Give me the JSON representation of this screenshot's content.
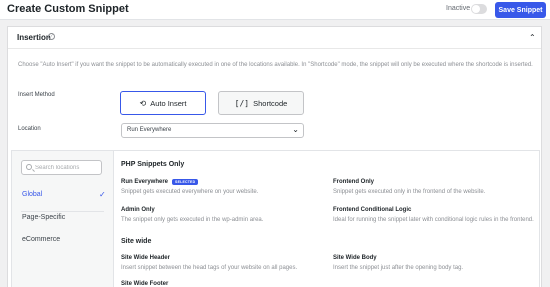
{
  "header": {
    "title": "Create Custom Snippet",
    "status_label": "Inactive",
    "save_label": "Save Snippet"
  },
  "insertion": {
    "title": "Insertion",
    "description": "Choose \"Auto Insert\" if you want the snippet to be automatically executed in one of the locations available. In \"Shortcode\" mode, the snippet will only be executed where the shortcode is inserted.",
    "method_label": "Insert Method",
    "methods": [
      {
        "icon": "refresh-icon",
        "label": "Auto Insert",
        "selected": true
      },
      {
        "icon": "shortcode-icon",
        "label": "Shortcode",
        "selected": false
      }
    ],
    "location_label": "Location",
    "location_value": "Run Everywhere"
  },
  "locations": {
    "search_placeholder": "Search locations",
    "nav": [
      {
        "label": "Global",
        "active": true
      },
      {
        "label": "Page-Specific",
        "active": false
      },
      {
        "label": "eCommerce",
        "active": false
      }
    ],
    "groups": [
      {
        "title": "PHP Snippets Only",
        "options": [
          {
            "title": "Run Everywhere",
            "badge": "SELECTED",
            "desc": "Snippet gets executed everywhere on your website."
          },
          {
            "title": "Frontend Only",
            "desc": "Snippet gets executed only in the frontend of the website."
          },
          {
            "title": "Admin Only",
            "desc": "The snippet only gets executed in the wp-admin area."
          },
          {
            "title": "Frontend Conditional Logic",
            "desc": "Ideal for running the snippet later with conditional logic rules in the frontend."
          }
        ]
      },
      {
        "title": "Site wide",
        "options": [
          {
            "title": "Site Wide Header",
            "desc": "Insert snippet between the head tags of your website on all pages."
          },
          {
            "title": "Site Wide Body",
            "desc": "Insert the snippet just after the opening body tag."
          },
          {
            "title": "Site Wide Footer",
            "desc": ""
          }
        ]
      }
    ]
  },
  "colors": {
    "accent": "#3858e9",
    "muted_text": "#8c8f94",
    "background": "#f0f0f1"
  }
}
